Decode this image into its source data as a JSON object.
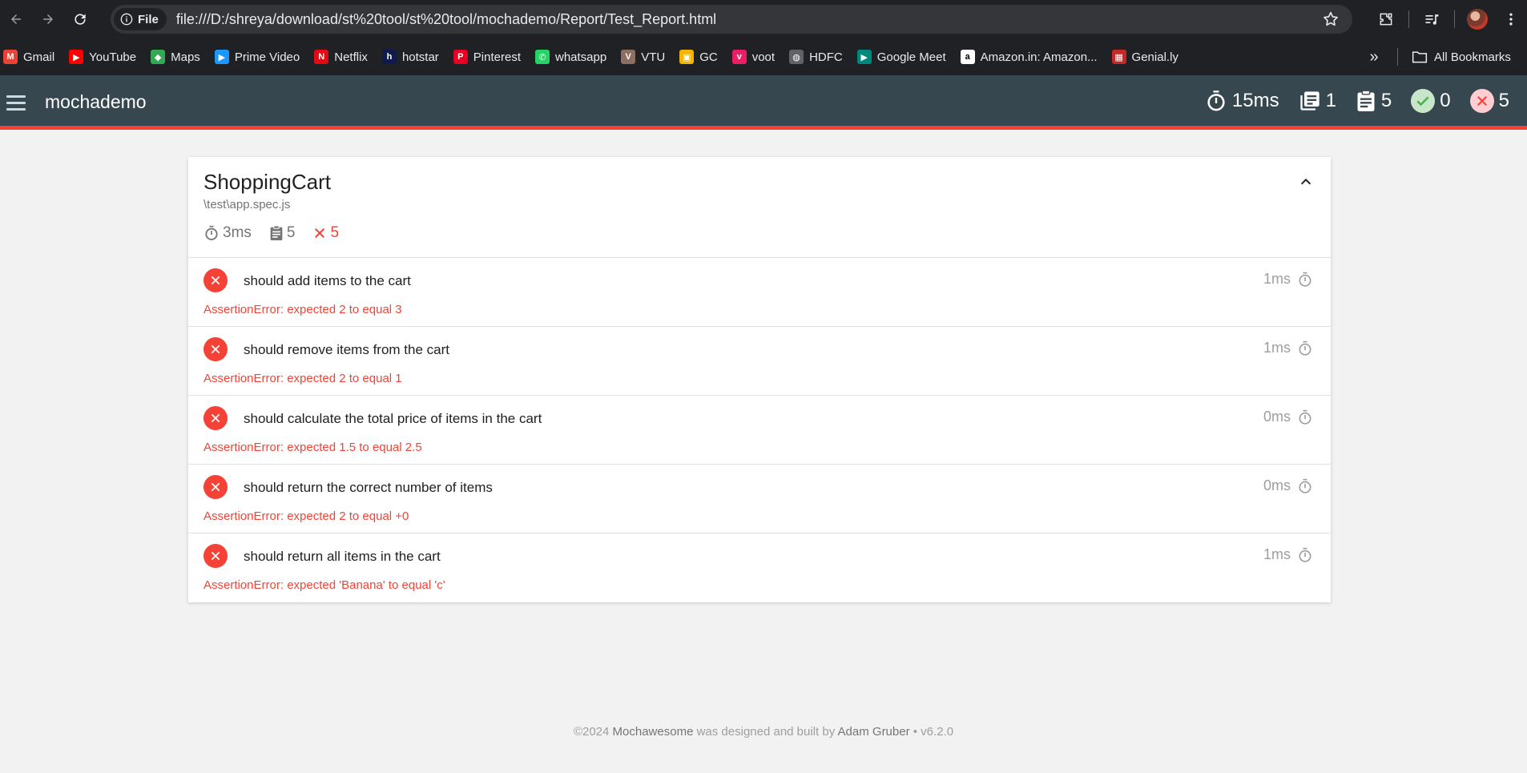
{
  "browser": {
    "file_chip": "File",
    "url": "file:///D:/shreya/download/st%20tool/st%20tool/mochademo/Report/Test_Report.html",
    "bookmarks": [
      {
        "label": "Gmail",
        "icon": "gmail-icon",
        "color": "#ea4335",
        "glyph": "M"
      },
      {
        "label": "YouTube",
        "icon": "youtube-icon",
        "color": "#ff0000",
        "glyph": "▶"
      },
      {
        "label": "Maps",
        "icon": "maps-icon",
        "color": "#34a853",
        "glyph": "◆"
      },
      {
        "label": "Prime Video",
        "icon": "prime-video-icon",
        "color": "#1a98ff",
        "glyph": "▶"
      },
      {
        "label": "Netflix",
        "icon": "netflix-icon",
        "color": "#e50914",
        "glyph": "N"
      },
      {
        "label": "hotstar",
        "icon": "hotstar-icon",
        "color": "#0f1b4c",
        "glyph": "h"
      },
      {
        "label": "Pinterest",
        "icon": "pinterest-icon",
        "color": "#e60023",
        "glyph": "P"
      },
      {
        "label": "whatsapp",
        "icon": "whatsapp-icon",
        "color": "#25d366",
        "glyph": "✆"
      },
      {
        "label": "VTU",
        "icon": "vtu-icon",
        "color": "#8d6e63",
        "glyph": "V"
      },
      {
        "label": "GC",
        "icon": "google-classroom-icon",
        "color": "#f4b400",
        "glyph": "▣"
      },
      {
        "label": "voot",
        "icon": "voot-icon",
        "color": "#e91e63",
        "glyph": "v"
      },
      {
        "label": "HDFC",
        "icon": "globe-icon",
        "color": "#5f6368",
        "glyph": "◍"
      },
      {
        "label": "Google Meet",
        "icon": "google-meet-icon",
        "color": "#00897b",
        "glyph": "▶"
      },
      {
        "label": "Amazon.in: Amazon...",
        "icon": "amazon-icon",
        "color": "#ffffff",
        "glyph": "a"
      },
      {
        "label": "Genial.ly",
        "icon": "genially-icon",
        "color": "#c62828",
        "glyph": "▦"
      }
    ],
    "all_bookmarks": "All Bookmarks"
  },
  "app": {
    "title": "mochademo",
    "stats": {
      "duration": "15ms",
      "suites": "1",
      "tests": "5",
      "passes": "0",
      "failures": "5"
    }
  },
  "suite": {
    "title": "ShoppingCart",
    "file": "\\test\\app.spec.js",
    "duration": "3ms",
    "tests": "5",
    "failures": "5",
    "items": [
      {
        "title": "should add items to the cart",
        "duration": "1ms",
        "error": "AssertionError: expected 2 to equal 3"
      },
      {
        "title": "should remove items from the cart",
        "duration": "1ms",
        "error": "AssertionError: expected 2 to equal 1"
      },
      {
        "title": "should calculate the total price of items in the cart",
        "duration": "0ms",
        "error": "AssertionError: expected 1.5 to equal 2.5"
      },
      {
        "title": "should return the correct number of items",
        "duration": "0ms",
        "error": "AssertionError: expected 2 to equal +0"
      },
      {
        "title": "should return all items in the cart",
        "duration": "1ms",
        "error": "AssertionError: expected 'Banana' to equal 'c'"
      }
    ]
  },
  "footer": {
    "prefix": "©2024 ",
    "product": "Mochawesome",
    "middle": " was designed and built by ",
    "author": "Adam Gruber",
    "version": " • v6.2.0"
  }
}
